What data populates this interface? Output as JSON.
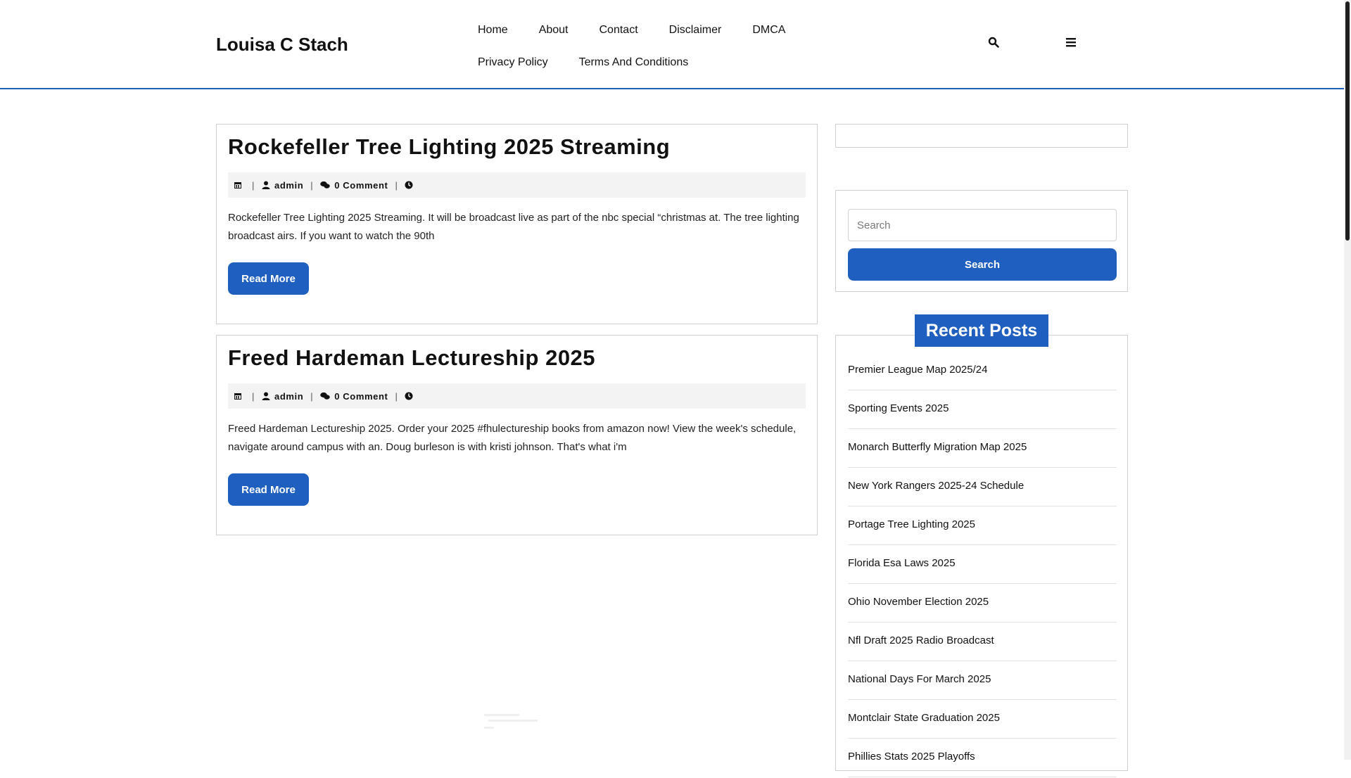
{
  "header": {
    "site_title": "Louisa C Stach",
    "nav": [
      {
        "label": "Home"
      },
      {
        "label": "About"
      },
      {
        "label": "Contact"
      },
      {
        "label": "Disclaimer"
      },
      {
        "label": "DMCA"
      },
      {
        "label": "Privacy Policy"
      },
      {
        "label": "Terms And Conditions"
      }
    ],
    "icons": {
      "search": "search-icon",
      "menu": "menu-icon"
    }
  },
  "posts": [
    {
      "title": "Rockefeller Tree Lighting 2025 Streaming",
      "author": "admin",
      "comments": "0 Comment",
      "excerpt": "Rockefeller Tree Lighting 2025 Streaming. It will be broadcast live as part of the nbc special “christmas at. The tree lighting broadcast airs. If you want to watch the 90th",
      "read_more": "Read More"
    },
    {
      "title": "Freed Hardeman Lectureship 2025",
      "author": "admin",
      "comments": "0 Comment",
      "excerpt": "Freed Hardeman Lectureship 2025. Order your 2025 #fhulectureship books from amazon now! View the week's schedule, navigate around campus with an. Doug burleson is with kristi johnson. That's what i'm",
      "read_more": "Read More"
    }
  ],
  "sidebar": {
    "search": {
      "placeholder": "Search",
      "button": "Search"
    },
    "recent_posts": {
      "heading": "Recent Posts",
      "items": [
        "Premier League Map 2025/24",
        "Sporting Events 2025",
        "Monarch Butterfly Migration Map 2025",
        "New York Rangers 2025-24 Schedule",
        "Portage Tree Lighting 2025",
        "Florida Esa Laws 2025",
        "Ohio November Election 2025",
        "Nfl Draft 2025 Radio Broadcast",
        "National Days For March 2025",
        "Montclair State Graduation 2025",
        "Phillies Stats 2025 Playoffs"
      ]
    }
  },
  "colors": {
    "accent": "#1f5fbf",
    "border": "#cfcfcf",
    "meta_bg": "#f3f3f3"
  }
}
